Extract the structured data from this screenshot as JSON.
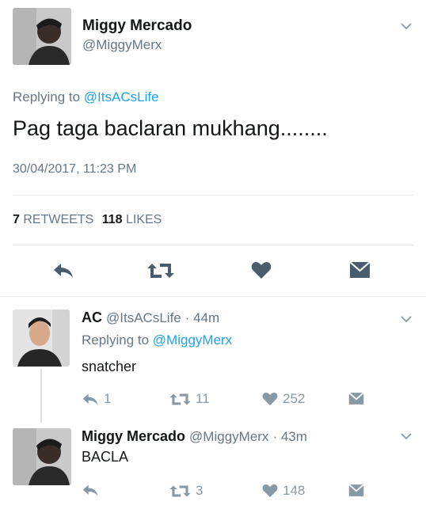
{
  "main_tweet": {
    "author_name": "Miggy Mercado",
    "author_handle": "@MiggyMerx",
    "replying_prefix": "Replying to",
    "replying_to": "@ItsACsLife",
    "text": "Pag taga baclaran mukhang........",
    "timestamp": "30/04/2017, 11:23 PM",
    "retweets_count": "7",
    "retweets_label": "RETWEETS",
    "likes_count": "118",
    "likes_label": "LIKES"
  },
  "reply1": {
    "author_name": "AC",
    "author_handle": "@ItsACsLife",
    "age": "· 44m",
    "replying_prefix": "Replying to",
    "replying_to": "@MiggyMerx",
    "text": "snatcher",
    "reply_count": "1",
    "retweet_count": "11",
    "like_count": "252"
  },
  "reply2": {
    "author_name": "Miggy Mercado",
    "author_handle": "@MiggyMerx",
    "age": "· 43m",
    "text": "BACLA",
    "retweet_count": "3",
    "like_count": "148"
  },
  "colors": {
    "link": "#1da1f2",
    "muted": "#657786",
    "icon": "#5a6d80",
    "divider": "#e6ecf0"
  },
  "icons": [
    "chevron-down-icon",
    "reply-icon",
    "retweet-icon",
    "heart-icon",
    "message-icon"
  ]
}
